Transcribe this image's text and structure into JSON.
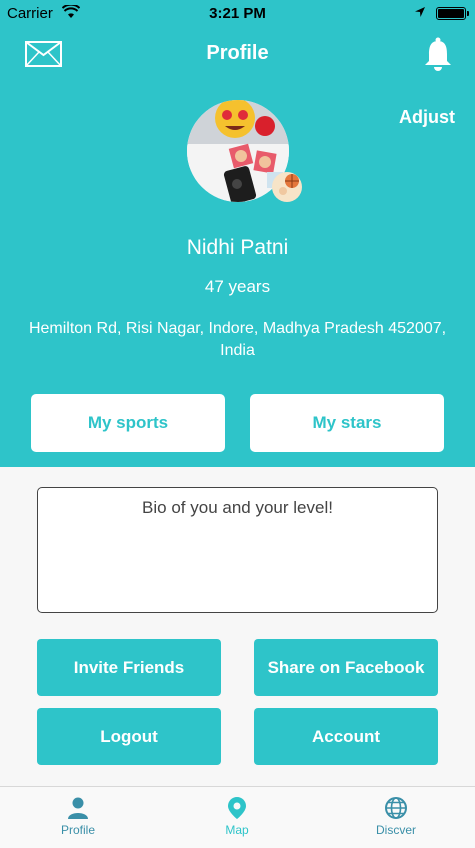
{
  "status": {
    "carrier": "Carrier",
    "time": "3:21 PM"
  },
  "header": {
    "title": "Profile",
    "adjust_label": "Adjust"
  },
  "profile": {
    "name": "Nidhi Patni",
    "age": "47 years",
    "address": "Hemilton Rd, Risi Nagar, Indore, Madhya Pradesh 452007, India"
  },
  "buttons": {
    "my_sports": "My sports",
    "my_stars": "My stars",
    "invite_friends": "Invite Friends",
    "share_facebook": "Share on Facebook",
    "logout": "Logout",
    "account": "Account"
  },
  "bio": {
    "placeholder": "Bio of you and your level!"
  },
  "tabs": [
    {
      "label": "Profile",
      "icon": "person-icon"
    },
    {
      "label": "Map",
      "icon": "map-pin-icon"
    },
    {
      "label": "Discver",
      "icon": "globe-icon"
    }
  ],
  "colors": {
    "accent": "#2ec4c9",
    "tab_inactive": "#3a8fa8"
  }
}
